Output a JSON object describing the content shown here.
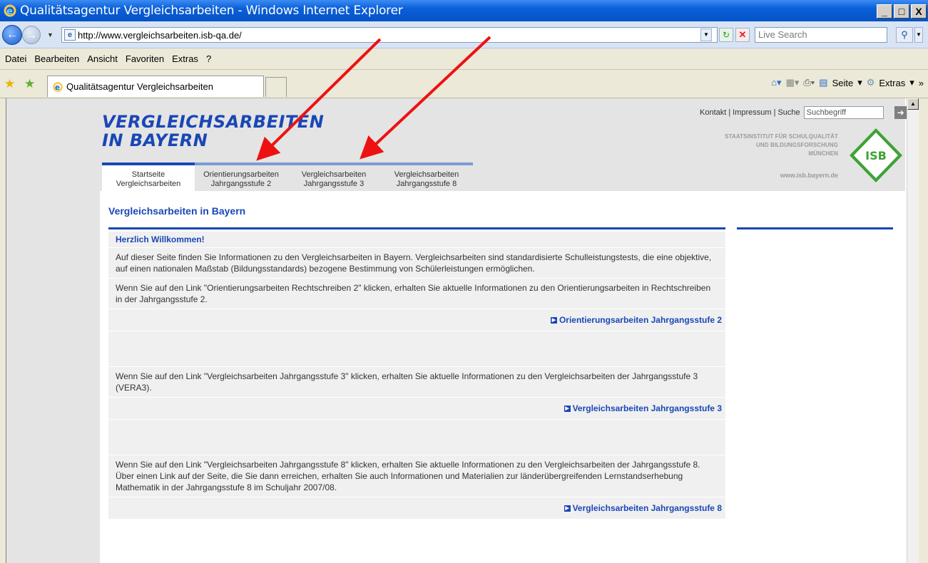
{
  "window": {
    "title": "Qualitätsagentur Vergleichsarbeiten - Windows Internet Explorer",
    "buttons": [
      "_",
      "□",
      "X"
    ]
  },
  "address": {
    "url": "http://www.vergleichsarbeiten.isb-qa.de/",
    "search_placeholder": "Live Search"
  },
  "menu": [
    "Datei",
    "Bearbeiten",
    "Ansicht",
    "Favoriten",
    "Extras",
    "?"
  ],
  "tab": {
    "label": "Qualitätsagentur Vergleichsarbeiten"
  },
  "commandbar": {
    "seite": "Seite",
    "extras": "Extras"
  },
  "page": {
    "logo_line1": "VERGLEICHSARBEITEN",
    "logo_line2": "IN BAYERN",
    "nav_tabs": [
      {
        "line1": "Startseite",
        "line2": "Vergleichsarbeiten"
      },
      {
        "line1": "Orientierungsarbeiten",
        "line2": "Jahrgangsstufe 2"
      },
      {
        "line1": "Vergleichsarbeiten",
        "line2": "Jahrgangsstufe 3"
      },
      {
        "line1": "Vergleichsarbeiten",
        "line2": "Jahrgangsstufe 8"
      }
    ],
    "toplinks": {
      "kontakt": "Kontakt",
      "impressum": "Impressum",
      "suche": "Suche",
      "search_value": "Suchbegriff"
    },
    "isb": {
      "line1": "STAATSINSTITUT FÜR SCHULQUALITÄT",
      "line2": "UND BILDUNGSFORSCHUNG",
      "line3": "MÜNCHEN",
      "web": "www.isb.bayern.de",
      "logo_text": "ISB"
    },
    "title": "Vergleichsarbeiten in Bayern",
    "welcome": "Herzlich Willkommen!",
    "intro": "Auf dieser Seite finden Sie Informationen zu den Vergleichsarbeiten in Bayern. Vergleichsarbeiten sind standardisierte Schulleistungstests, die eine objektive, auf einen nationalen Maßstab (Bildungsstandards) bezogene Bestimmung von Schülerleistungen ermöglichen.",
    "para2": "Wenn Sie auf den Link \"Orientierungsarbeiten Rechtschreiben 2\" klicken, erhalten Sie aktuelle Informationen zu den Orientierungsarbeiten in Rechtschreiben in der Jahrgangsstufe 2.",
    "link2": "Orientierungsarbeiten Jahrgangsstufe 2",
    "para3": "Wenn Sie auf den Link \"Vergleichsarbeiten Jahrgangsstufe 3\" klicken, erhalten Sie aktuelle Informationen zu den Vergleichsarbeiten der Jahrgangsstufe 3 (VERA3).",
    "link3": "Vergleichsarbeiten Jahrgangsstufe 3",
    "para8": "Wenn Sie auf den Link \"Vergleichsarbeiten Jahrgangsstufe 8\" klicken, erhalten Sie aktuelle Informationen zu den Vergleichsarbeiten der Jahrgangsstufe 8. Über einen Link auf der Seite, die Sie dann erreichen, erhalten Sie auch Informationen und Materialien zur länderübergreifenden Lernstandserhebung Mathematik in der Jahrgangsstufe 8 im Schuljahr 2007/08.",
    "link8": "Vergleichsarbeiten Jahrgangsstufe 8"
  },
  "colors": {
    "brand_blue": "#1a47b6",
    "annotation_red": "#ee1111"
  }
}
